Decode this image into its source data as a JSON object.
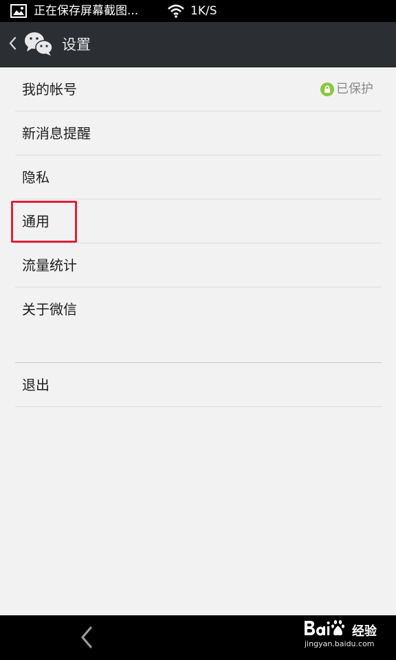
{
  "status_bar": {
    "notification_text": "正在保存屏幕截图...",
    "network_speed": "1K/S",
    "icons": [
      "image-icon",
      "wifi-icon"
    ]
  },
  "title_bar": {
    "title": "设置",
    "back_icon": "chevron-left-icon",
    "logo_icon": "wechat-logo-icon"
  },
  "settings": {
    "items": [
      {
        "label": "我的帐号",
        "status": "已保护",
        "status_icon": "lock-icon",
        "status_color": "#8cc63f"
      },
      {
        "label": "新消息提醒"
      },
      {
        "label": "隐私"
      },
      {
        "label": "通用",
        "highlighted": true
      },
      {
        "label": "流量统计"
      },
      {
        "label": "关于微信"
      }
    ],
    "logout_label": "退出"
  },
  "colors": {
    "title_bar_bg": "#2b2e32",
    "background": "#f2f2f2",
    "highlight_border": "#e0203a"
  },
  "nav_bar": {
    "back_icon": "nav-back-icon"
  },
  "watermark": {
    "word": "经验",
    "url": "jingyan.baidu.com"
  }
}
